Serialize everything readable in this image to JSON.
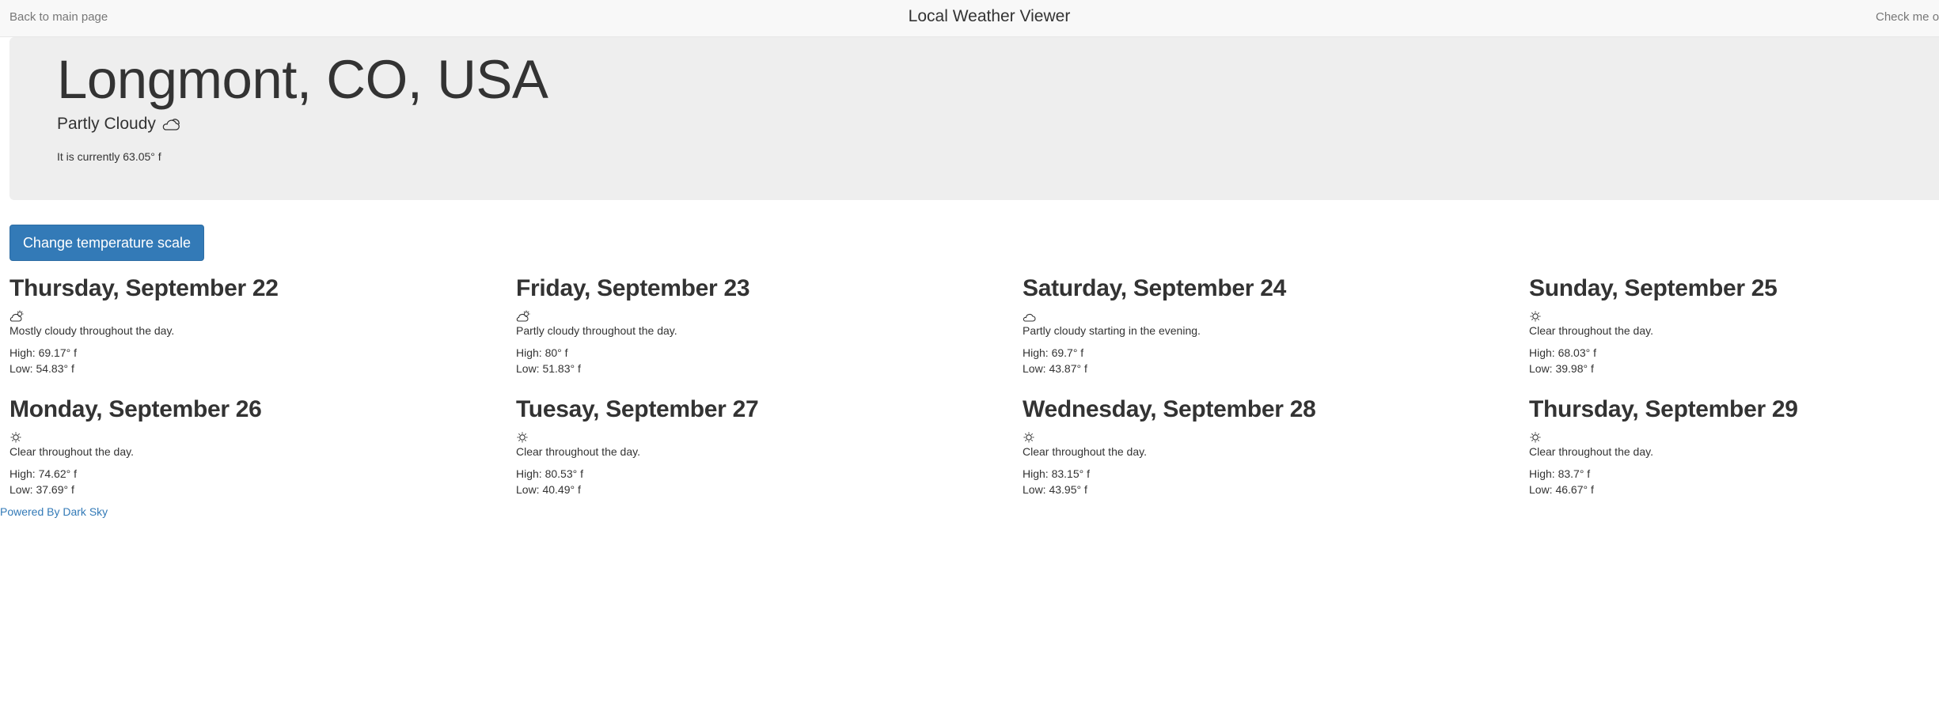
{
  "nav": {
    "back_label": "Back to main page",
    "title": "Local Weather Viewer",
    "check_label": "Check me ou"
  },
  "current": {
    "city": "Longmont, CO, USA",
    "summary": "Partly Cloudy",
    "summary_icon": "partly-cloudy-icon",
    "currently_text": "It is currently 63.05° f"
  },
  "controls": {
    "scale_button": "Change temperature scale"
  },
  "forecast": [
    {
      "day": "Thursday, September 22",
      "icon": "partly-cloudy-day-icon",
      "desc": "Mostly cloudy throughout the day.",
      "high": "High: 69.17° f",
      "low": "Low: 54.83° f"
    },
    {
      "day": "Friday, September 23",
      "icon": "partly-cloudy-day-icon",
      "desc": "Partly cloudy throughout the day.",
      "high": "High: 80° f",
      "low": "Low: 51.83° f"
    },
    {
      "day": "Saturday, September 24",
      "icon": "cloudy-icon",
      "desc": "Partly cloudy starting in the evening.",
      "high": "High: 69.7° f",
      "low": "Low: 43.87° f"
    },
    {
      "day": "Sunday, September 25",
      "icon": "clear-day-icon",
      "desc": "Clear throughout the day.",
      "high": "High: 68.03° f",
      "low": "Low: 39.98° f"
    },
    {
      "day": "Monday, September 26",
      "icon": "clear-day-icon",
      "desc": "Clear throughout the day.",
      "high": "High: 74.62° f",
      "low": "Low: 37.69° f"
    },
    {
      "day": "Tuesay, September 27",
      "icon": "clear-day-icon",
      "desc": "Clear throughout the day.",
      "high": "High: 80.53° f",
      "low": "Low: 40.49° f"
    },
    {
      "day": "Wednesday, September 28",
      "icon": "clear-day-icon",
      "desc": "Clear throughout the day.",
      "high": "High: 83.15° f",
      "low": "Low: 43.95° f"
    },
    {
      "day": "Thursday, September 29",
      "icon": "clear-day-icon",
      "desc": "Clear throughout the day.",
      "high": "High: 83.7° f",
      "low": "Low: 46.67° f"
    }
  ],
  "footer": {
    "powered_label": "Powered By Dark Sky"
  }
}
